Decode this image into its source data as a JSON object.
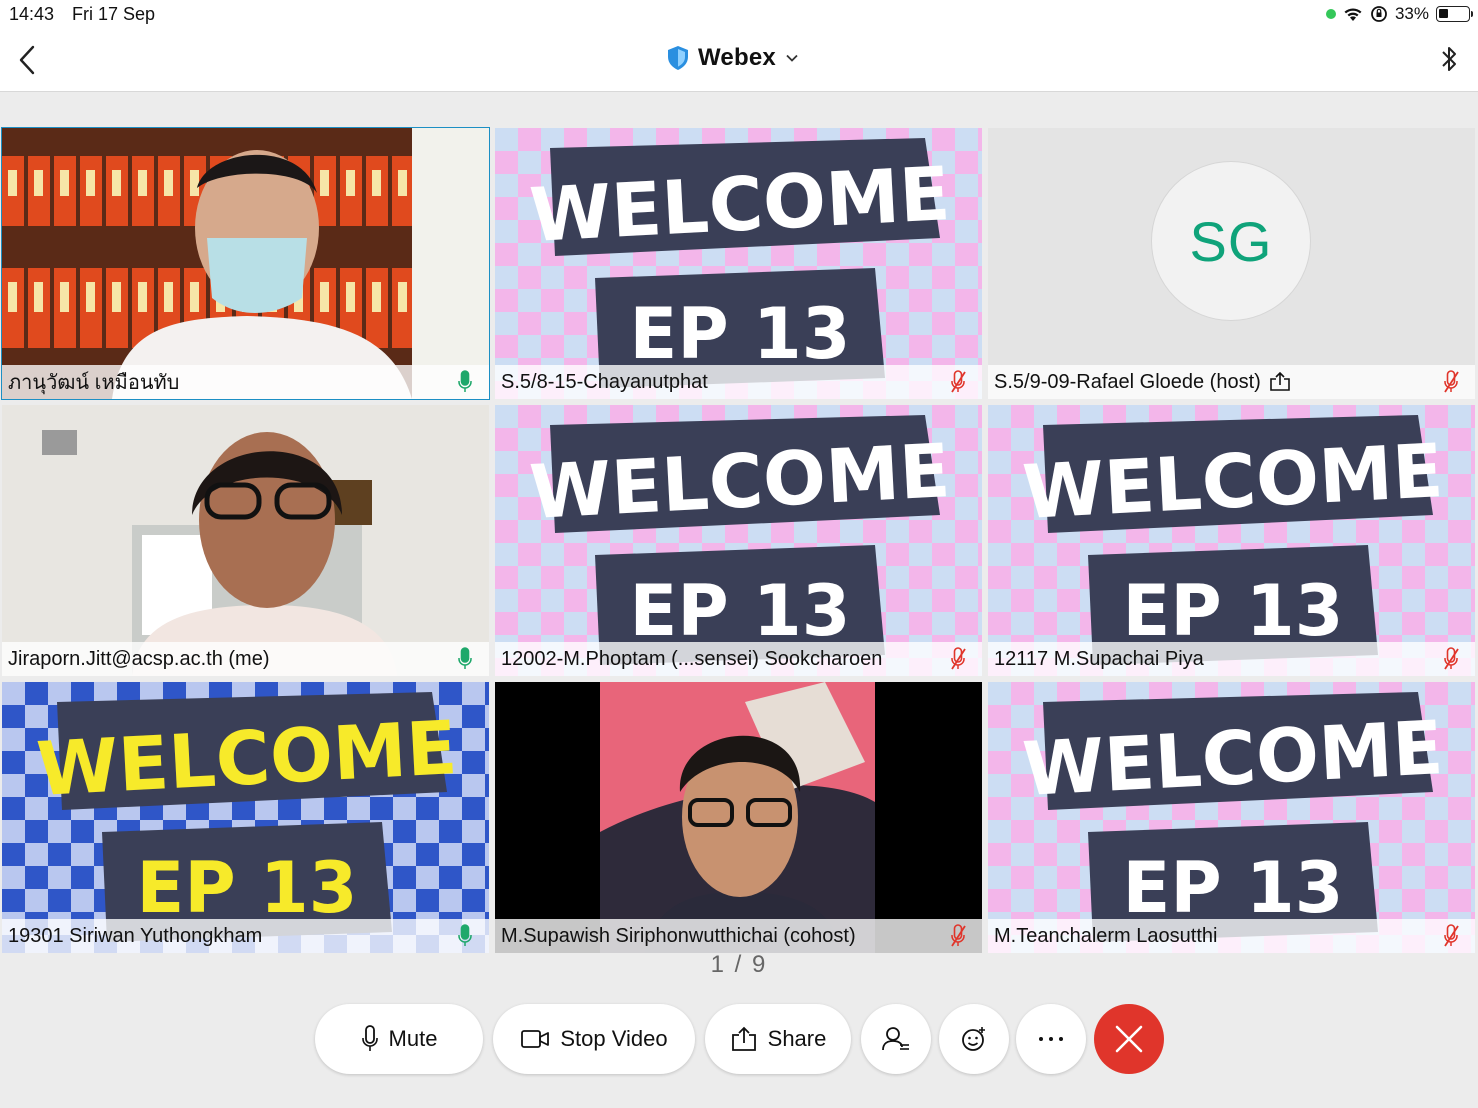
{
  "status_bar": {
    "time": "14:43",
    "date": "Fri 17 Sep",
    "battery": "33%",
    "battery_level": 0.33
  },
  "header": {
    "title": "Webex",
    "shield_color": "#2a8fe0"
  },
  "tiles": [
    {
      "name": "ภานุวัฒน์ เหมือนทับ",
      "mic": "on",
      "active": true,
      "video": "office"
    },
    {
      "name": "S.5/8-15-Chayanutphat",
      "mic": "muted",
      "video": "welcome-pink"
    },
    {
      "name": "S.5/9-09-Rafael Gloede (host)",
      "mic": "muted",
      "video": "avatar",
      "initials": "SG",
      "sharing": true
    },
    {
      "name": "Jiraporn.Jitt@acsp.ac.th (me)",
      "mic": "on",
      "video": "office-2"
    },
    {
      "name": "12002-M.Phoptam (...sensei) Sookcharoen",
      "mic": "muted",
      "video": "welcome-pink"
    },
    {
      "name": "12117 M.Supachai Piya",
      "mic": "muted",
      "video": "welcome-pink"
    },
    {
      "name": "19301 Siriwan Yuthongkham",
      "mic": "on",
      "video": "welcome-blue"
    },
    {
      "name": "M.Supawish Siriphonwutthichai (cohost)",
      "mic": "muted",
      "video": "dark"
    },
    {
      "name": "M.Teanchalerm Laosutthi",
      "mic": "muted",
      "video": "welcome-pink"
    }
  ],
  "background_text": {
    "welcome": "WELCOME",
    "ep": "EP 13"
  },
  "pagination": "1 / 9",
  "controls": {
    "mute": "Mute",
    "stop_video": "Stop Video",
    "share": "Share"
  },
  "colors": {
    "mic_on": "#1fa86b",
    "mic_muted": "#e0352b",
    "active_border": "#1c8fc4",
    "end_call": "#e0352b"
  }
}
